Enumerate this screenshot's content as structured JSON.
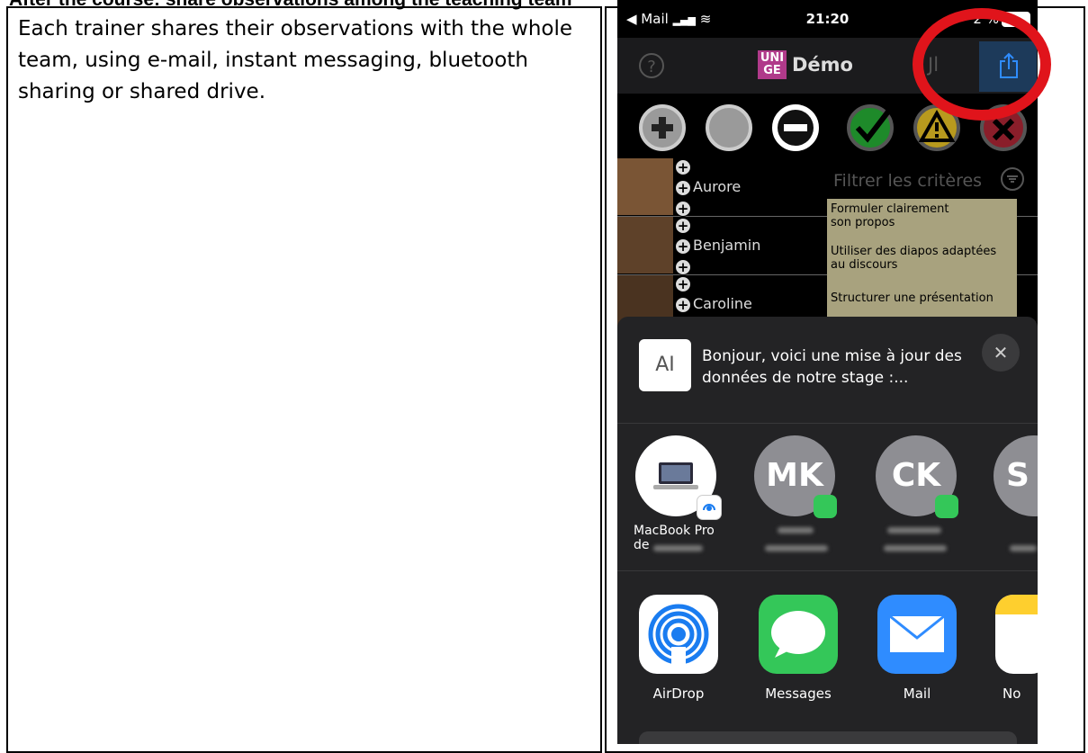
{
  "document": {
    "heading": "After the course: share observations among the teaching team",
    "description": "Each trainer shares their observations with the whole team, using e-mail, instant messaging, bluetooth sharing or shared drive."
  },
  "status_bar": {
    "back_app": "◀ Mail",
    "time": "21:20",
    "battery": "2 %"
  },
  "nav": {
    "help_icon": "?",
    "logo_text": "UNI GE",
    "title": "Démo",
    "partial_title": "Jl"
  },
  "toolbar": {
    "icons": [
      "plus-circle-icon",
      "circle-icon",
      "minus-circle-icon",
      "check-icon",
      "warning-icon",
      "cross-icon"
    ]
  },
  "students": [
    {
      "name": "Aurore"
    },
    {
      "name": "Benjamin"
    },
    {
      "name": "Caroline"
    }
  ],
  "filter": {
    "placeholder": "Filtrer les critères"
  },
  "criteria": [
    {
      "line1": "Formuler clairement",
      "line2": "son propos"
    },
    {
      "line1": "Utiliser des diapos adaptées",
      "line2": "au discours"
    },
    {
      "line1": "Structurer une présentation",
      "line2": ""
    }
  ],
  "share_sheet": {
    "preview_text": "Bonjour, voici une mise à jour des données de notre stage :...",
    "preview_thumb": "AI",
    "close": "✕",
    "contacts": [
      {
        "initials": "",
        "label_line1": "MacBook Pro",
        "label_line2": "de"
      },
      {
        "initials": "MK",
        "label_line1": "",
        "label_line2": ""
      },
      {
        "initials": "CK",
        "label_line1": "",
        "label_line2": ""
      },
      {
        "initials": "S",
        "label_line1": "",
        "label_line2": ""
      }
    ],
    "apps": [
      {
        "label": "AirDrop"
      },
      {
        "label": "Messages"
      },
      {
        "label": "Mail"
      },
      {
        "label": "No"
      }
    ]
  },
  "colors": {
    "highlight_ring": "#e0141b",
    "criteria_bg": "#a8a27e",
    "share_button_bg": "#1d3a5a"
  }
}
